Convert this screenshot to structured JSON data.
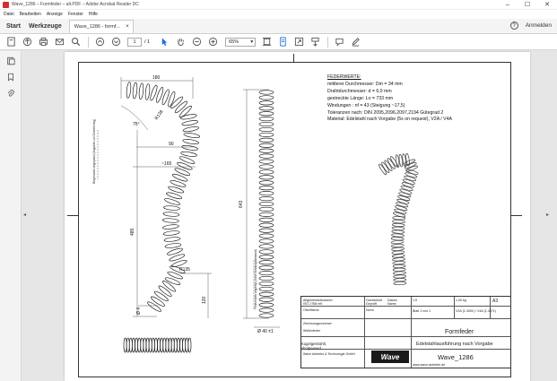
{
  "window": {
    "title": "Wave_1286 – Formfeder – alt.PDF – Adobe Acrobat Reader DC",
    "controls": [
      "–",
      "☐",
      "✕"
    ]
  },
  "menu": [
    "Datei",
    "Bearbeiten",
    "Anzeige",
    "Fenster",
    "Hilfe"
  ],
  "tabs": {
    "home": "Start",
    "tools": "Werkzeuge",
    "document": "Wave_1286 - formf...",
    "close": "×",
    "help": "?",
    "signin": "Anmelden"
  },
  "toolbar": {
    "page_current": "1",
    "page_total": "/ 1",
    "zoom": "65%",
    "zoom_arrow": "▾"
  },
  "nav": {
    "left_arrow": "◂",
    "right_arrow": "▸"
  },
  "drawing": {
    "spec_head": "FEDERWERTE:",
    "spec_lines": [
      "mittlerer Durchmesser: Dm = 34 mm",
      "Drahtdurchmesser: d = 6,0 mm",
      "gestreckte Länge: Lo = 733 mm",
      "Windungen : nf = 43 (Steigung ~17,5)",
      "Toleranzen nach: DIN 2095,2096,2097,2194 Gütegrad 2",
      "Material: Edelstahl nach Vorgabe (5s on request), V2A / V4A"
    ],
    "dimensions": {
      "top_width": "180",
      "radius_top": "R138",
      "angle": "75°",
      "width_90": "90",
      "width_165": "~165",
      "height_485": "485",
      "height_643": "643",
      "radius_bottom": "R135",
      "height_120": "120",
      "dia_4": "Ø 4",
      "dia_40": "Ø 40 ±1",
      "note_left": "Biegeradien angepasst (Angaben zur Orientierung)",
      "note_right": "Federenden angelegt (ohne Windungsabstand)"
    }
  },
  "title_block": {
    "formfeder": "Formfeder",
    "ausfuehrung": "Edelstahlausführung nach Vorgabe",
    "logo": "Wave",
    "part_number": "Wave_1286",
    "material_label": "Kugelgestrahlt, shotpeened",
    "scale": "1:5",
    "sheet": "A3",
    "weight": "1,00 kg",
    "material_code": "V2A (1.4301) / V4A (1.4571)",
    "company_line": "Wave Antriebs & Technologie GmbH",
    "misc_text": [
      "Allgemeintoleranzen",
      "ISO 2768 mK",
      "Oberfläche",
      "Gezeichnet",
      "Geprüft",
      "Norm",
      "Datum",
      "Name",
      "Blatt 1 von 1",
      "Zeichnungsnummer",
      "Wellenfeder",
      "www.wave-antriebe.de"
    ]
  }
}
